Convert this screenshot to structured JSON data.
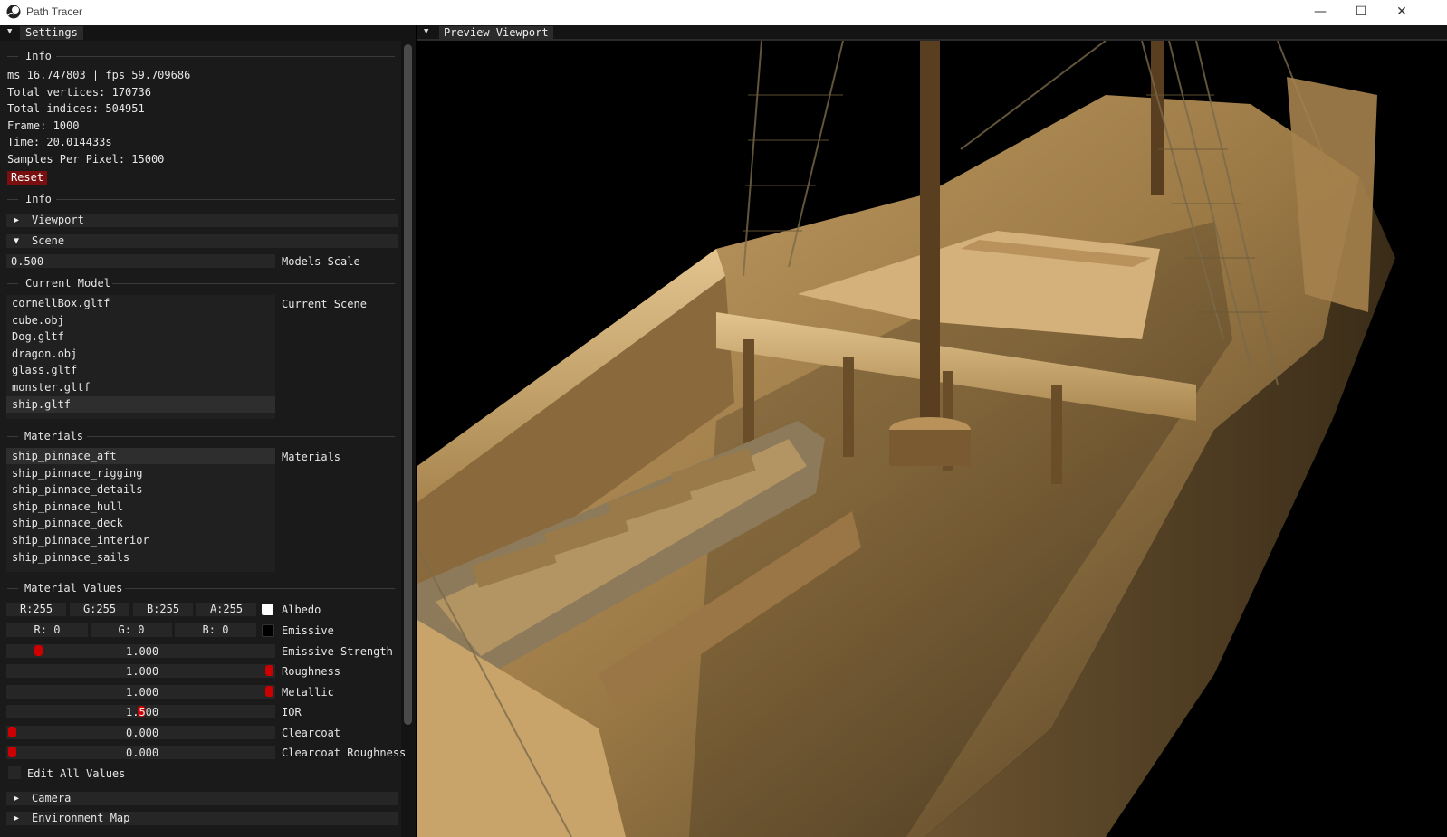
{
  "window": {
    "title": "Path Tracer",
    "minimize": "—",
    "maximize": "☐",
    "close": "✕"
  },
  "settings_tab": "Settings",
  "info": {
    "header": "Info",
    "ms_fps": "ms 16.747803 | fps 59.709686",
    "vertices": "Total vertices: 170736",
    "indices": "Total indices: 504951",
    "frame": "Frame: 1000",
    "time": "Time: 20.014433s",
    "spp": "Samples Per Pixel: 15000",
    "reset": "Reset",
    "footer": "Info"
  },
  "sections": {
    "viewport": "Viewport",
    "scene": "Scene",
    "camera": "Camera",
    "environment": "Environment Map"
  },
  "scene": {
    "scale_value": "0.500",
    "scale_label": "Models Scale",
    "current_model_header": "Current Model",
    "current_scene_label": "Current Scene",
    "models": [
      "cornellBox.gltf",
      "cube.obj",
      "Dog.gltf",
      "dragon.obj",
      "glass.gltf",
      "monster.gltf",
      "ship.gltf"
    ],
    "selected_model": "ship.gltf"
  },
  "materials": {
    "header": "Materials",
    "label": "Materials",
    "items": [
      "ship_pinnace_aft",
      "ship_pinnace_rigging",
      "ship_pinnace_details",
      "ship_pinnace_hull",
      "ship_pinnace_deck",
      "ship_pinnace_interior",
      "ship_pinnace_sails"
    ],
    "selected": "ship_pinnace_aft"
  },
  "material_values": {
    "header": "Material Values",
    "albedo": {
      "r": "R:255",
      "g": "G:255",
      "b": "B:255",
      "a": "A:255",
      "label": "Albedo",
      "color": "#ffffff"
    },
    "emissive": {
      "r": "R:  0",
      "g": "G:  0",
      "b": "B:  0",
      "label": "Emissive",
      "color": "#000000"
    },
    "emissive_strength": {
      "value": "1.000",
      "label": "Emissive Strength"
    },
    "roughness": {
      "value": "1.000",
      "label": "Roughness"
    },
    "metallic": {
      "value": "1.000",
      "label": "Metallic"
    },
    "ior": {
      "value": "1.500",
      "label": "IOR"
    },
    "clearcoat": {
      "value": "0.000",
      "label": "Clearcoat"
    },
    "clearcoat_roughness": {
      "value": "0.000",
      "label": "Clearcoat Roughness"
    },
    "edit_all": "Edit All Values"
  },
  "preview_tab": "Preview Viewport",
  "colors": {
    "accent": "#cc0000",
    "reset_bg": "#7a0f0f",
    "panel_bg": "#1a1a1a"
  }
}
